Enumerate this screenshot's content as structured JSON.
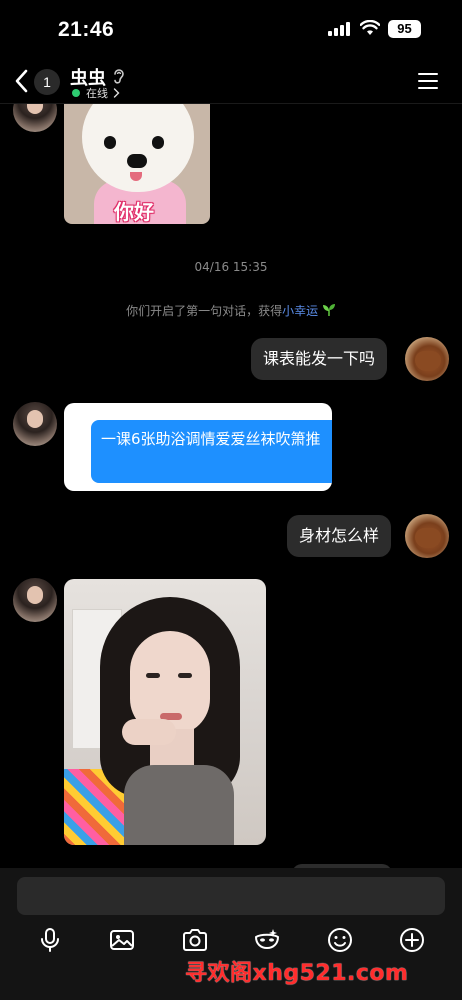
{
  "status_bar": {
    "time": "21:46",
    "battery": "95"
  },
  "header": {
    "unread_count": "1",
    "contact_name": "虫虫",
    "online_status": "在线"
  },
  "messages": {
    "sticker_text": "你好",
    "timestamp": "04/16 15:35",
    "system_text": "你们开启了第一句对话，获得",
    "system_link": "小幸运",
    "msg_out_1": "课表能发一下吗",
    "card_text": "一课6张助浴调情爱爱丝袜吹箫推",
    "msg_out_2": "身材怎么样"
  },
  "composer": {
    "tools": [
      "mic-icon",
      "image-icon",
      "camera-icon",
      "mask-icon",
      "emoji-icon",
      "plus-icon"
    ]
  },
  "watermark": "寻欢阁xhg521.com",
  "colors": {
    "background": "#000000",
    "outgoing_bubble": "#2c2c2c",
    "card_bubble": "#1e90ff",
    "online_dot": "#2ecc71",
    "link": "#5b8de8",
    "watermark": "#ff2d2d"
  }
}
